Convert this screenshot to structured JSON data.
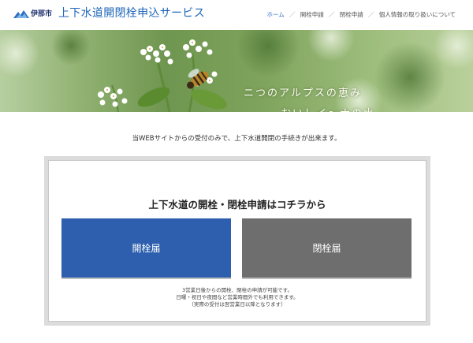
{
  "header": {
    "logo_text": "伊那市",
    "site_title": "上下水道開閉栓申込サービス",
    "nav": [
      {
        "label": "ホーム"
      },
      {
        "label": "開栓申請"
      },
      {
        "label": "閉栓申請"
      },
      {
        "label": "個人情報の取り扱いについて"
      }
    ],
    "nav_separator": "／"
  },
  "hero": {
    "line1": "ニつのアルプスの恵み",
    "line2": "おいしイ〜ナの水"
  },
  "intro_text": "当WEBサイトからの受付のみで、上下水道開閉の手続きが出来ます。",
  "panel": {
    "title": "上下水道の開栓・閉栓申請はコチラから",
    "open_button": "開栓届",
    "close_button": "閉栓届",
    "notes": [
      "3営業日後からの開栓、閉栓の申請が可能です。",
      "日曜・祝日や夜間など営業時間外でも利用できます。",
      "（実際の受付は翌営業日以降となります）"
    ]
  },
  "colors": {
    "title_blue": "#1f66b8",
    "open_button": "#2d5fae",
    "close_button": "#6e6e6e",
    "panel_border": "#dcdcdc"
  },
  "icons": {
    "logo": "ina-city-logo-icon"
  }
}
